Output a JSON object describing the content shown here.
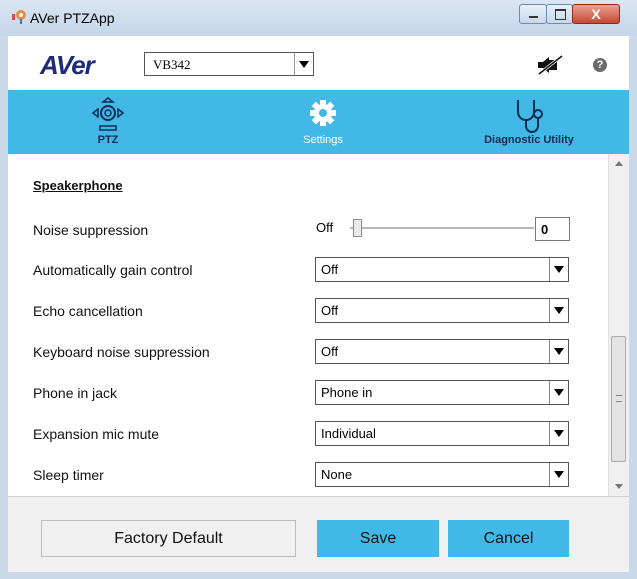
{
  "window": {
    "title": "AVer PTZApp",
    "close_glyph": "X"
  },
  "header": {
    "logo_text": "AVer",
    "device_selected": "VB342",
    "help_glyph": "?",
    "icons": [
      "mic-muted-icon",
      "help-icon"
    ]
  },
  "nav": {
    "tabs": [
      {
        "label": "PTZ",
        "icon": "ptz-icon",
        "active": false
      },
      {
        "label": "Settings",
        "icon": "gear-icon",
        "active": true
      },
      {
        "label": "Diagnostic Utility",
        "icon": "stethoscope-icon",
        "active": false
      }
    ],
    "accent_color": "#41b8e6"
  },
  "settings": {
    "section_title": "Speakerphone",
    "noise_suppression": {
      "label": "Noise suppression",
      "slider_min_label": "Off",
      "value": "0"
    },
    "rows": [
      {
        "label": "Automatically gain control",
        "value": "Off"
      },
      {
        "label": "Echo cancellation",
        "value": "Off"
      },
      {
        "label": "Keyboard noise suppression",
        "value": "Off"
      },
      {
        "label": "Phone in jack",
        "value": "Phone in"
      },
      {
        "label": "Expansion mic mute",
        "value": "Individual"
      },
      {
        "label": "Sleep timer",
        "value": "None"
      }
    ]
  },
  "footer": {
    "factory_default_label": "Factory Default",
    "save_label": "Save",
    "cancel_label": "Cancel"
  }
}
